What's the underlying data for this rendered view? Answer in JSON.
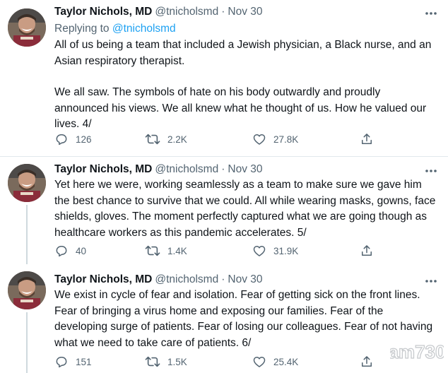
{
  "tweets": [
    {
      "name": "Taylor Nichols, MD",
      "handle": "@tnicholsmd",
      "separator": "·",
      "date": "Nov 30",
      "reply_prefix": "Replying to",
      "reply_handle": "@tnicholsmd",
      "paragraphs": [
        "All of us being a team that included a Jewish physician, a Black nurse, and an Asian respiratory therapist.",
        "We all saw. The symbols of hate on his body outwardly and proudly announced his views. We all knew what he thought of us. How he valued our lives. 4/"
      ],
      "replies": "126",
      "retweets": "2.2K",
      "likes": "27.8K"
    },
    {
      "name": "Taylor Nichols, MD",
      "handle": "@tnicholsmd",
      "separator": "·",
      "date": "Nov 30",
      "paragraphs": [
        "Yet here we were, working seamlessly as a team to make sure we gave him the best chance to survive that we could. All while wearing masks, gowns, face shields, gloves. The moment perfectly captured what we are going though as healthcare workers as this pandemic accelerates. 5/"
      ],
      "replies": "40",
      "retweets": "1.4K",
      "likes": "31.9K"
    },
    {
      "name": "Taylor Nichols, MD",
      "handle": "@tnicholsmd",
      "separator": "·",
      "date": "Nov 30",
      "paragraphs": [
        "We exist in cycle of fear and isolation. Fear of getting sick on the front lines. Fear of bringing a virus home and exposing our families. Fear of the developing surge of patients. Fear of losing our colleagues. Fear of not having what we need to take care of patients. 6/"
      ],
      "replies": "151",
      "retweets": "1.5K",
      "likes": "25.4K"
    }
  ],
  "icons": {
    "reply": "comment-icon",
    "retweet": "retweet-icon",
    "like": "heart-icon",
    "share": "share-icon",
    "more": "more-horizontal-icon"
  },
  "watermark": "am730",
  "colors": {
    "text": "#0f1419",
    "secondary": "#536471",
    "link": "#1da1f2",
    "divider": "#e1e8ed"
  }
}
